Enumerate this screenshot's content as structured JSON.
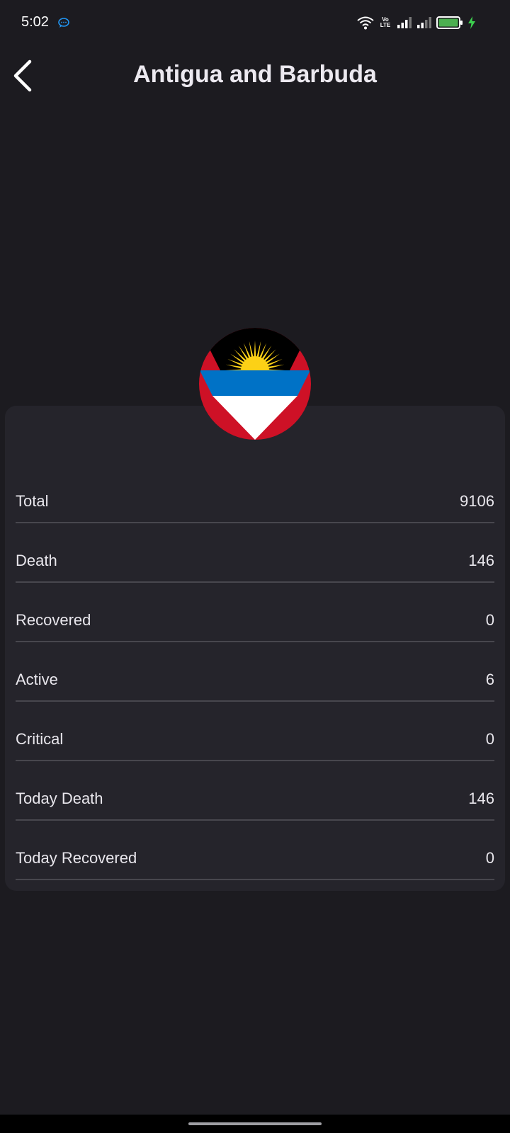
{
  "status_bar": {
    "time": "5:02",
    "network_label_top": "Vo",
    "network_label_bottom": "LTE",
    "battery_color": "#4caf50",
    "charging_color": "#3ccf4e",
    "icons": [
      "chat-bubble-icon",
      "wifi-icon",
      "volte-icon",
      "signal-icon",
      "signal-icon",
      "battery-icon",
      "charging-bolt-icon"
    ]
  },
  "header": {
    "title": "Antigua and Barbuda",
    "back_icon": "chevron-left-icon"
  },
  "flag": {
    "country": "Antigua and Barbuda",
    "colors": {
      "black": "#000000",
      "sun": "#fcd116",
      "blue": "#0072c6",
      "white": "#ffffff",
      "red": "#ce1126"
    }
  },
  "stats": [
    {
      "label": "Total",
      "value": "9106"
    },
    {
      "label": "Death",
      "value": "146"
    },
    {
      "label": "Recovered",
      "value": "0"
    },
    {
      "label": "Active",
      "value": "6"
    },
    {
      "label": "Critical",
      "value": "0"
    },
    {
      "label": "Today Death",
      "value": "146"
    },
    {
      "label": "Today Recovered",
      "value": "0"
    }
  ],
  "colors": {
    "background": "#1c1b20",
    "card": "#25242b",
    "divider": "#48474e",
    "text": "#e8e6ec"
  }
}
